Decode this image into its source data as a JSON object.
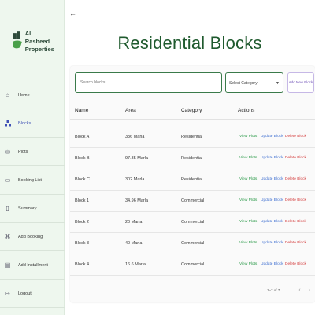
{
  "brand": {
    "line1": "Al Rasheed",
    "line2": "Properties"
  },
  "nav": [
    {
      "id": "home",
      "label": "Home",
      "icon": "home-icon"
    },
    {
      "id": "blocks",
      "label": "Blocks",
      "icon": "blocks-icon"
    },
    {
      "id": "plots",
      "label": "Plots",
      "icon": "plots-icon"
    },
    {
      "id": "booking-list",
      "label": "Booking List",
      "icon": "booking-list-icon"
    },
    {
      "id": "summary",
      "label": "Summary",
      "icon": "summary-icon"
    },
    {
      "id": "add-booking",
      "label": "Add Booking",
      "icon": "add-booking-icon"
    },
    {
      "id": "add-installment",
      "label": "Add Installment",
      "icon": "add-installment-icon"
    },
    {
      "id": "logout",
      "label": "Logout",
      "icon": "logout-icon"
    }
  ],
  "page": {
    "title": "Residential Blocks",
    "back_icon": "back-arrow-icon"
  },
  "toolbar": {
    "search_placeholder": "Search blocks",
    "select_value": "Select Category",
    "add_label": "Add New Block"
  },
  "table": {
    "headers": {
      "name": "Name",
      "area": "Area",
      "category": "Category",
      "actions": "Actions"
    },
    "action_labels": {
      "view": "View Plots",
      "update": "Update Block",
      "delete": "Delete Block"
    },
    "rows": [
      {
        "name": "Block A",
        "area": "336 Marla",
        "category": "Residential"
      },
      {
        "name": "Block B",
        "area": "97.35 Marla",
        "category": "Residential"
      },
      {
        "name": "Block C",
        "area": "302 Marla",
        "category": "Residential"
      },
      {
        "name": "Block 1",
        "area": "34.96 Marla",
        "category": "Commercial"
      },
      {
        "name": "Block 2",
        "area": "20 Marla",
        "category": "Commercial"
      },
      {
        "name": "Block 3",
        "area": "40 Marla",
        "category": "Commercial"
      },
      {
        "name": "Block 4",
        "area": "16.6 Marla",
        "category": "Commercial"
      }
    ]
  },
  "pagination": {
    "range": "1–7 of 7"
  },
  "colors": {
    "title": "#1f5a2e",
    "sidebar": "#eef7ee",
    "view": "#2e9b4b",
    "update": "#3f6fd0",
    "delete": "#d33a3a"
  }
}
